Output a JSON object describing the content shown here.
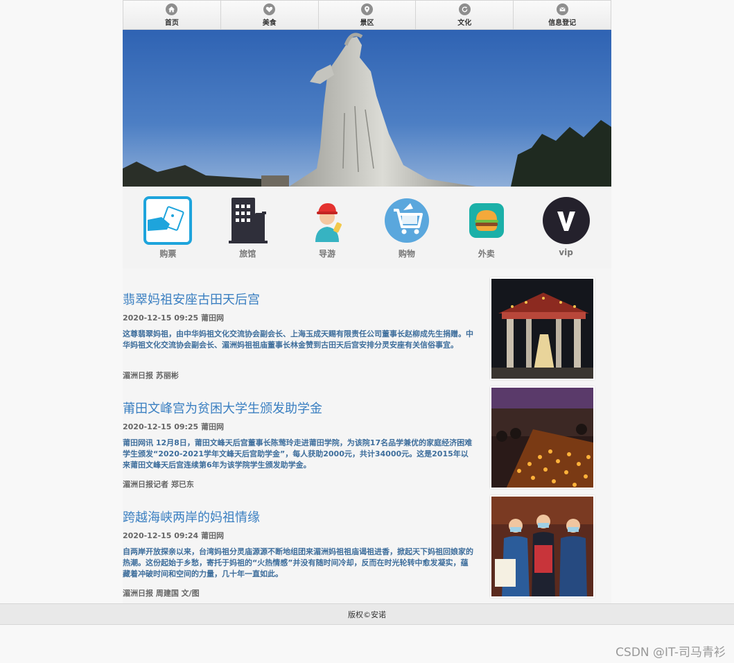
{
  "nav": {
    "items": [
      {
        "label": "首页",
        "icon": "home-icon"
      },
      {
        "label": "美食",
        "icon": "heart-icon"
      },
      {
        "label": "景区",
        "icon": "location-pin-icon"
      },
      {
        "label": "文化",
        "icon": "refresh-icon"
      },
      {
        "label": "信息登记",
        "icon": "mail-icon"
      }
    ]
  },
  "banner": {
    "alt_subject": "mazu-statue"
  },
  "services": [
    {
      "label": "购票",
      "icon": "ticket-icon",
      "color": "#1ea4dc"
    },
    {
      "label": "旅馆",
      "icon": "building-icon",
      "color": "#2f2f3a"
    },
    {
      "label": "导游",
      "icon": "tour-guide-icon",
      "color": "#e4322f"
    },
    {
      "label": "购物",
      "icon": "shopping-cart-icon",
      "color": "#5aa7dd"
    },
    {
      "label": "外卖",
      "icon": "burger-icon",
      "color": "#1bb0a8"
    },
    {
      "label": "vip",
      "icon": "vip-icon",
      "color": "#24212c"
    }
  ],
  "articles": [
    {
      "title": "翡翠妈祖安座古田天后宫",
      "meta": "2020-12-15 09:25 莆田网",
      "body": "这尊翡翠妈祖，由中华妈祖文化交流协会副会长、上海玉成天赐有限责任公司董事长赵柳成先生捐赠。中华妈祖文化交流协会副会长、湄洲妈祖祖庙董事长林金赞到古田天后宫安排分灵安座有关信俗事宜。",
      "source": "湄洲日报 苏丽彬",
      "thumb": "temple-gate-photo"
    },
    {
      "title": "莆田文峰宫为贫困大学生颁发助学金",
      "meta": "2020-12-15 09:25 莆田网",
      "body": "莆田网讯 12月8日，莆田文峰天后宫董事长陈莺玲走进莆田学院，为该院17名品学兼优的家庭经济困难学生颁发“2020-2021学年文峰天后宫助学金”，每人获助2000元，共计34000元。这是2015年以来莆田文峰天后宫连续第6年为该学院学生颁发助学金。",
      "source": "湄洲日报记者 郑已东",
      "thumb": "candles-photo"
    },
    {
      "title": "跨越海峡两岸的妈祖情缘",
      "meta": "2020-12-15 09:24 莆田网",
      "body": "自两岸开放探亲以来，台湾妈祖分灵庙源源不断地组团来湄洲妈祖祖庙谒祖进香，掀起天下妈祖回娘家的热潮。这份起始于乡愁，寄托于妈祖的“火热情感”并没有随时间冷却，反而在时光轮转中愈发凝实，蕴藏着冲破时间和空间的力量，几十年一直如此。",
      "source": "湄洲日报 周建国 文/图",
      "thumb": "people-masks-photo"
    }
  ],
  "footer": {
    "copyright": "版权©安诺"
  },
  "watermark": "CSDN @IT-司马青衫"
}
